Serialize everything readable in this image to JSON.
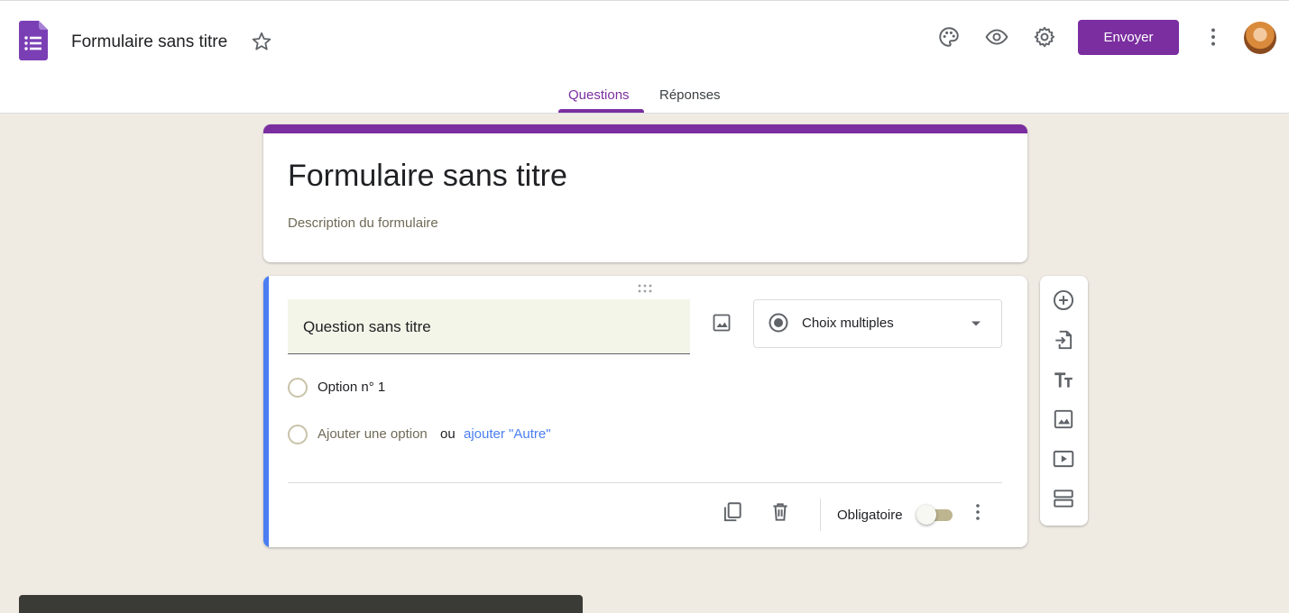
{
  "header": {
    "doc_title": "Formulaire sans titre",
    "send_label": "Envoyer",
    "icons": [
      "forms-logo-icon",
      "star-icon",
      "palette-icon",
      "eye-icon",
      "gear-icon",
      "more-vert-icon"
    ],
    "accent_color": "#7b2ea0"
  },
  "tabs": [
    {
      "label": "Questions",
      "active": true
    },
    {
      "label": "Réponses",
      "active": false
    }
  ],
  "form": {
    "title": "Formulaire sans titre",
    "description": "Description du formulaire"
  },
  "question": {
    "title": "Question sans titre",
    "type": "Choix multiples",
    "options": [
      "Option n° 1"
    ],
    "add_option": "Ajouter une option",
    "or": "ou",
    "add_other": "ajouter \"Autre\"",
    "required_label": "Obligatoire",
    "required": false,
    "accent_color": "#4a7ef2"
  },
  "toolbar": {
    "icons": [
      "add-circle-icon",
      "import-questions-icon",
      "title-text-icon",
      "image-icon",
      "video-icon",
      "section-icon"
    ]
  }
}
